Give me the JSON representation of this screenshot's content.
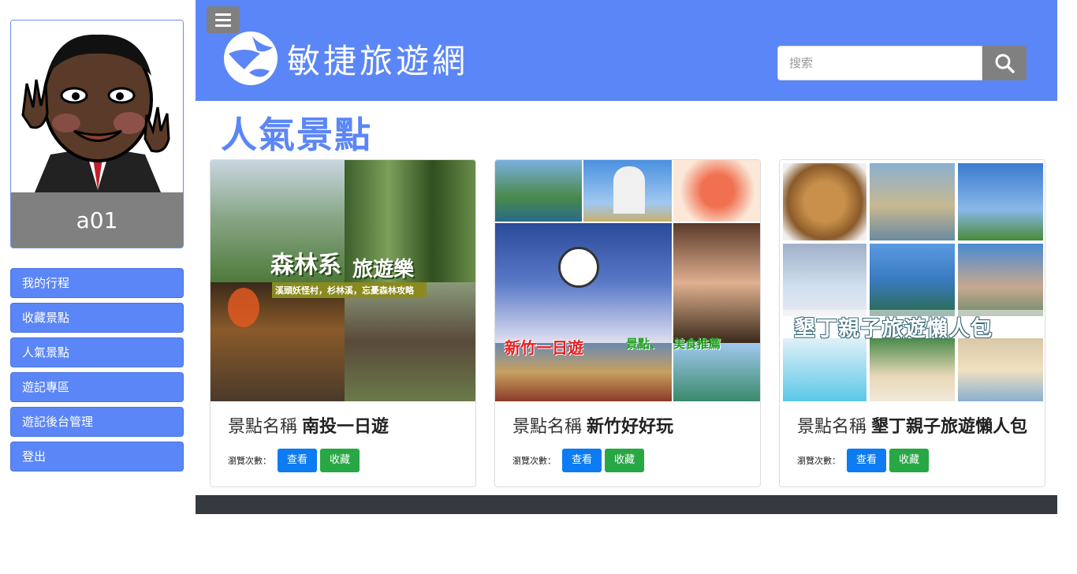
{
  "sidebar": {
    "username": "a01",
    "menu": [
      {
        "label": "我的行程"
      },
      {
        "label": "收藏景點"
      },
      {
        "label": "人氣景點"
      },
      {
        "label": "遊記專區"
      },
      {
        "label": "遊記後台管理"
      },
      {
        "label": "登出"
      }
    ]
  },
  "header": {
    "site_title": "敏捷旅遊網",
    "search_placeholder": "搜索"
  },
  "main": {
    "section_title": "人氣景點",
    "cards": [
      {
        "label": "景點名稱",
        "name": "南投一日遊",
        "views_label": "瀏覽次數：",
        "view_button": "查看",
        "fav_button": "收藏",
        "image_text": [
          "森林系",
          "旅遊樂",
          "溪頭妖怪村，杉林溪，忘憂森林攻略"
        ]
      },
      {
        "label": "景點名稱",
        "name": "新竹好好玩",
        "views_label": "瀏覽次數：",
        "view_button": "查看",
        "fav_button": "收藏",
        "image_text": [
          "新竹一日遊",
          "景點、",
          "美食推薦"
        ]
      },
      {
        "label": "景點名稱",
        "name": "墾丁親子旅遊懶人包",
        "views_label": "瀏覽次數：",
        "view_button": "查看",
        "fav_button": "收藏",
        "image_text": [
          "墾丁親子旅遊懶人包"
        ]
      }
    ]
  },
  "colors": {
    "primary": "#5b86f7",
    "gray": "#808080",
    "blue_btn": "#0d7bf2",
    "green_btn": "#28a745",
    "footer": "#343a40"
  }
}
